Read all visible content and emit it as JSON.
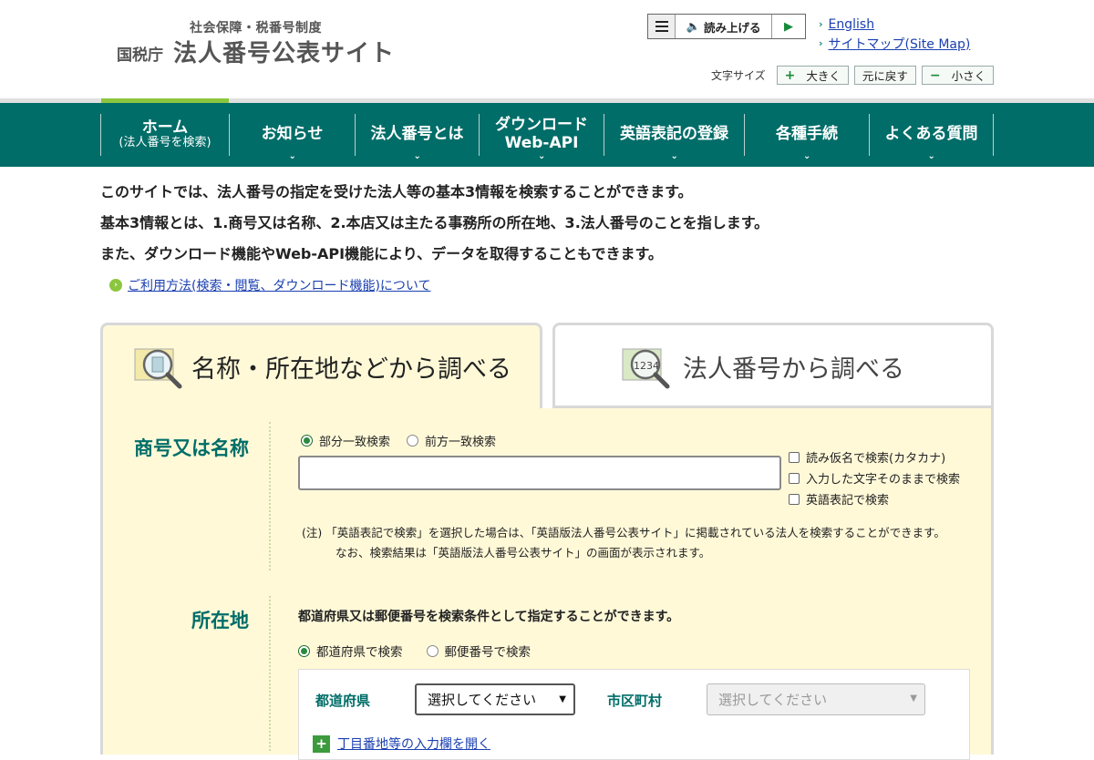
{
  "header": {
    "logo_sub": "社会保障・税番号制度",
    "logo_agency": "国税庁",
    "logo_title": "法人番号公表サイト",
    "readbar": {
      "label": "読み上げる"
    },
    "links": [
      "English",
      "サイトマップ(Site Map)"
    ],
    "fontsize": {
      "label": "文字サイズ",
      "bigger": "大きく",
      "reset": "元に戻す",
      "smaller": "小さく"
    }
  },
  "nav": [
    {
      "line1": "ホーム",
      "line2": "(法人番号を検索)"
    },
    {
      "line1": "お知らせ"
    },
    {
      "line1": "法人番号とは"
    },
    {
      "line1": "ダウンロード",
      "line2": "Web-API"
    },
    {
      "line1": "英語表記の登録"
    },
    {
      "line1": "各種手続"
    },
    {
      "line1": "よくある質問"
    }
  ],
  "intro": {
    "lines": [
      "このサイトでは、法人番号の指定を受けた法人等の基本3情報を検索することができます。",
      "基本3情報とは、1.商号又は名称、2.本店又は主たる事務所の所在地、3.法人番号のことを指します。",
      "また、ダウンロード機能やWeb-API機能により、データを取得することもできます。"
    ],
    "link": "ご利用方法(検索・閲覧、ダウンロード機能)について"
  },
  "tabs": {
    "active": "名称・所在地などから調べる",
    "inactive": "法人番号から調べる"
  },
  "name_section": {
    "label": "商号又は名称",
    "radio_partial": "部分一致検索",
    "radio_prefix": "前方一致検索",
    "input_value": "",
    "checks": [
      "読み仮名で検索(カタカナ)",
      "入力した文字そのままで検索",
      "英語表記で検索"
    ],
    "note_prefix": "(注)",
    "note_line1": "「英語表記で検索」を選択した場合は、「英語版法人番号公表サイト」に掲載されている法人を検索することができます。",
    "note_line2": "なお、検索結果は「英語版法人番号公表サイト」の画面が表示されます。"
  },
  "address_section": {
    "label": "所在地",
    "desc": "都道府県又は郵便番号を検索条件として指定することができます。",
    "radio_pref": "都道府県で検索",
    "radio_zip": "郵便番号で検索",
    "pref_label": "都道府県",
    "pref_select": "選択してください",
    "city_label": "市区町村",
    "city_select": "選択してください",
    "open_link": "丁目番地等の入力欄を開く"
  },
  "colors": {
    "nav": "#006d68",
    "panel": "#fff9d8",
    "accent": "#8cc63f"
  }
}
